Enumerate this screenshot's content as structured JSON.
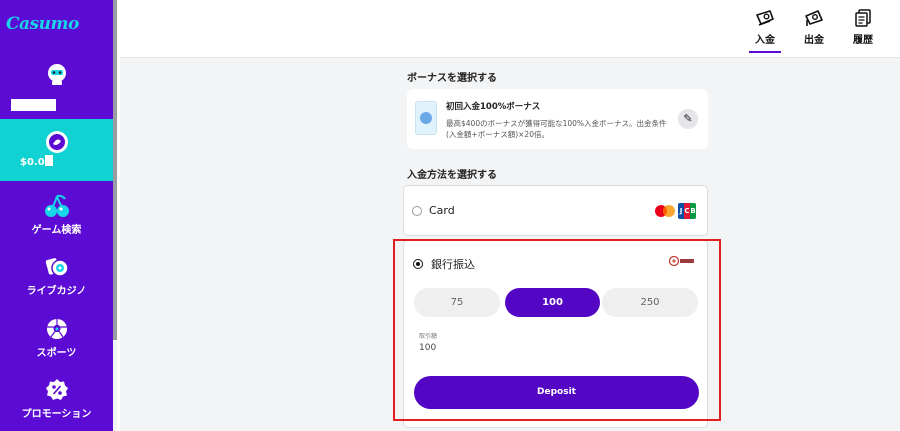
{
  "sidebar": {
    "logo": "Casumo",
    "balance": "$0.0",
    "items": [
      {
        "label": "ゲーム検索",
        "icon": "cherries-icon"
      },
      {
        "label": "ライブカジノ",
        "icon": "live-casino-icon"
      },
      {
        "label": "スポーツ",
        "icon": "soccer-ball-icon"
      },
      {
        "label": "プロモーション",
        "icon": "percent-badge-icon"
      }
    ]
  },
  "topbar": {
    "tabs": [
      {
        "label": "入金",
        "icon": "wallet-in-icon",
        "active": true
      },
      {
        "label": "出金",
        "icon": "wallet-out-icon",
        "active": false
      },
      {
        "label": "履歴",
        "icon": "history-icon",
        "active": false
      }
    ]
  },
  "bonus": {
    "section_title": "ボーナスを選択する",
    "name": "初回入金100%ボーナス",
    "description": "最高$400のボーナスが獲得可能な100%入金ボーナス。出金条件(入金額+ボーナス額)×20倍。"
  },
  "payment": {
    "section_title": "入金方法を選択する",
    "card_label": "Card",
    "bank_label": "銀行振込",
    "amounts": [
      "75",
      "100",
      "250"
    ],
    "selected_amount": "100",
    "fee_label": "取引額",
    "fee_value": "100",
    "deposit_label": "Deposit"
  },
  "colors": {
    "brand_purple": "#5b0bd3",
    "accent_teal": "#10d2d2",
    "button_purple": "#5307c5",
    "highlight_red": "#e41e1e"
  }
}
